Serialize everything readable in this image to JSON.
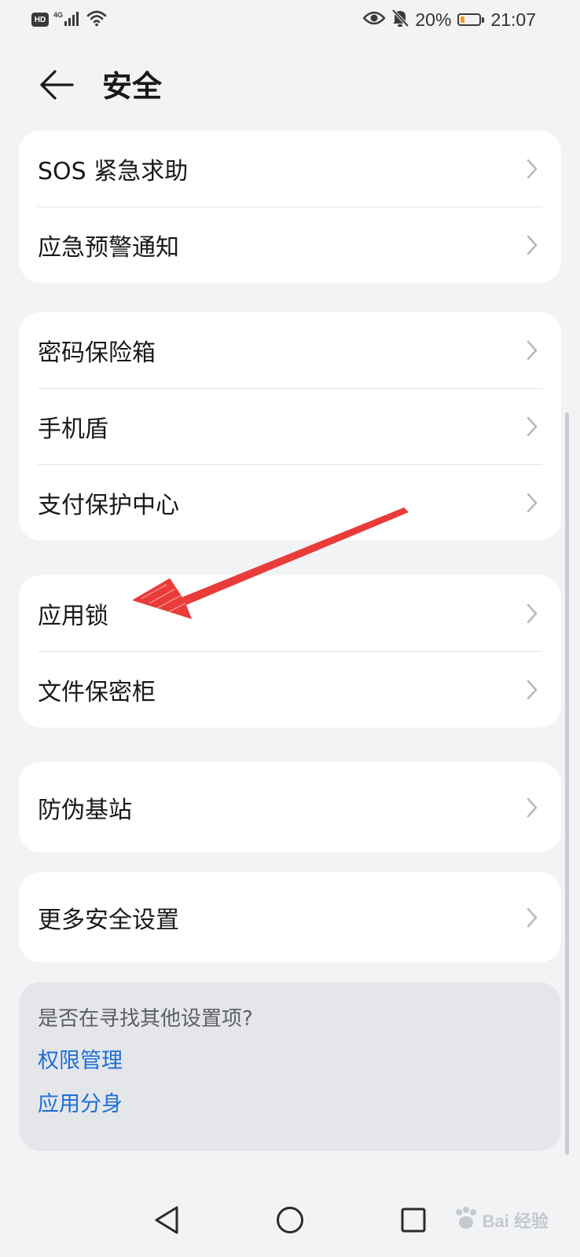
{
  "status_bar": {
    "hd_label": "HD",
    "network_label": "4G",
    "battery_percent": "20%",
    "battery_level": 0.2,
    "battery_color": "#f39a1e",
    "time": "21:07",
    "icons": [
      "signal-icon",
      "wifi-icon",
      "eye-icon",
      "bell-off-icon",
      "battery-icon"
    ]
  },
  "header": {
    "back_icon": "arrow-left-icon",
    "title": "安全"
  },
  "groups": [
    {
      "items": [
        {
          "label": "SOS 紧急求助"
        },
        {
          "label": "应急预警通知"
        }
      ]
    },
    {
      "items": [
        {
          "label": "密码保险箱"
        },
        {
          "label": "手机盾"
        },
        {
          "label": "支付保护中心"
        }
      ]
    },
    {
      "items": [
        {
          "label": "应用锁"
        },
        {
          "label": "文件保密柜"
        }
      ]
    },
    {
      "items": [
        {
          "label": "防伪基站"
        }
      ]
    },
    {
      "items": [
        {
          "label": "更多安全设置"
        }
      ]
    }
  ],
  "suggestions": {
    "title": "是否在寻找其他设置项?",
    "links": [
      {
        "label": "权限管理"
      },
      {
        "label": "应用分身"
      }
    ]
  },
  "annotation": {
    "type": "red-arrow",
    "color": "#ea3b3b",
    "points_to": "应用锁"
  },
  "nav_bar": {
    "icons": [
      "back-triangle-icon",
      "home-circle-icon",
      "recents-square-icon"
    ]
  },
  "watermark": {
    "text": "Bai 经验"
  },
  "colors": {
    "background": "#f1f3f5",
    "card": "#ffffff",
    "link": "#1e6ed6",
    "suggest_bg": "#e4e6ea"
  }
}
